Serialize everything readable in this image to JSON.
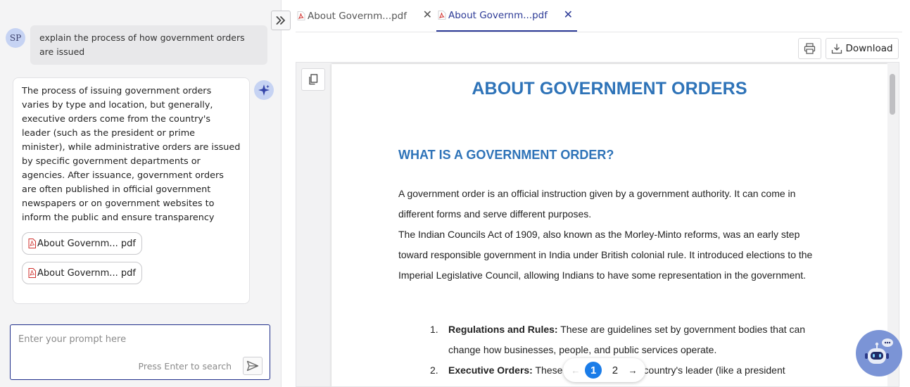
{
  "chat": {
    "user_initials": "SP",
    "user_message": "explain the process of how government orders are issued",
    "bot_message": "The process of issuing government orders varies by type and location, but generally, executive orders come from the country's leader (such as the president or prime minister), while administrative orders are issued by specific government departments or agencies. After issuance, government orders are often published in official government newspapers or on government websites to inform the public and ensure transparency",
    "sources": [
      {
        "label": "About Governm... pdf"
      },
      {
        "label": "About Governm... pdf"
      }
    ],
    "prompt_placeholder": "Enter your prompt here",
    "prompt_hint": "Press Enter to search"
  },
  "tabs": [
    {
      "label": "About Governm...pdf",
      "active": false
    },
    {
      "label": "About Governm...pdf",
      "active": true
    }
  ],
  "toolbar": {
    "download_label": "Download"
  },
  "document": {
    "title": "ABOUT GOVERNMENT ORDERS",
    "heading": "WHAT IS A GOVERNMENT ORDER?",
    "para1": "A government order is an official instruction given by a government authority. It can come in different forms and serve different purposes.",
    "para2": "The Indian Councils Act of 1909, also known as the Morley-Minto reforms, was an early step toward responsible government in India under British colonial rule. It introduced elections to the Imperial Legislative Council, allowing Indians to have some representation in the government.",
    "list": [
      {
        "num": "1.",
        "term": "Regulations and Rules:",
        "text": " These are guidelines set by government bodies that can change how businesses, people, and public services operate."
      },
      {
        "num": "2.",
        "term": "Executive Orders:",
        "text": " These are orders from a country's leader (like a president"
      }
    ]
  },
  "pager": {
    "pages": [
      "1",
      "2"
    ],
    "current": "1",
    "prev_symbol": "←",
    "next_symbol": "→"
  },
  "colors": {
    "accent": "#2c3a96",
    "doc_heading": "#2e73b8",
    "pager_active": "#1a7ce8",
    "pdf_red": "#d0312d"
  }
}
